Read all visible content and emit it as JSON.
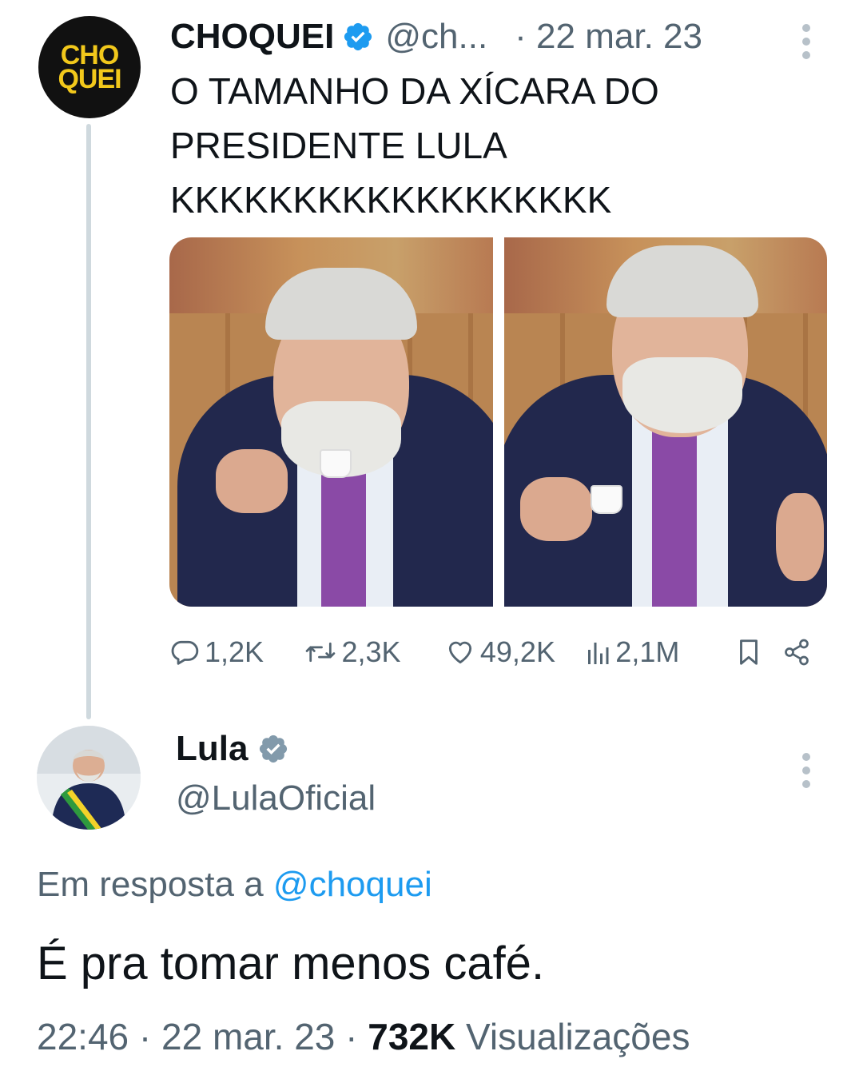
{
  "parent_tweet": {
    "avatar_text": [
      "CHO",
      "QUEI"
    ],
    "name": "CHOQUEI",
    "handle": "@ch...",
    "date": "· 22 mar. 23",
    "text_lines": [
      "O TAMANHO DA XÍCARA DO",
      "PRESIDENTE LULA",
      "KKKKKKKKKKKKKKKKKK"
    ],
    "actions": {
      "replies": "1,2K",
      "retweets": "2,3K",
      "likes": "49,2K",
      "views": "2,1M"
    }
  },
  "reply_tweet": {
    "name": "Lula",
    "handle": "@LulaOficial",
    "reply_prefix": "Em resposta a",
    "reply_handle": "@choquei",
    "text": "É pra tomar menos café.",
    "time": "22:46",
    "date": "22 mar. 23",
    "views_count": "732K",
    "views_label": "Visualizações"
  },
  "icons": [
    "verified-badge-icon",
    "more-icon",
    "reply-icon",
    "retweet-icon",
    "like-icon",
    "views-icon",
    "bookmark-icon",
    "share-icon"
  ],
  "colors": {
    "text": "#0f1419",
    "secondary": "#536471",
    "link": "#1d9bf0",
    "verified": "#829aab",
    "thread_line": "#cfd9de"
  }
}
